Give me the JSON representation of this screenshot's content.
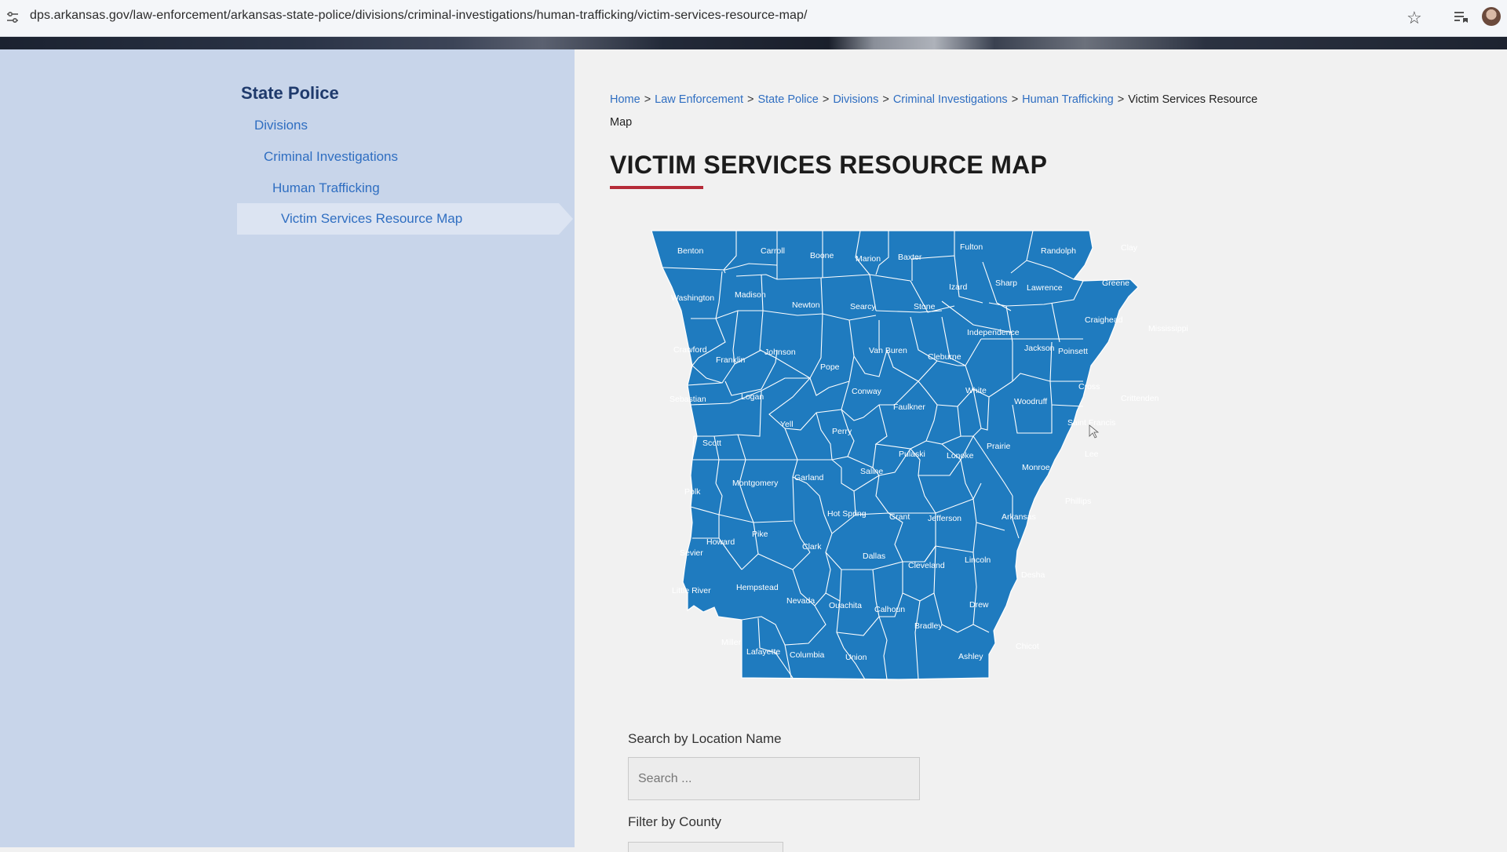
{
  "browser": {
    "url": "dps.arkansas.gov/law-enforcement/arkansas-state-police/divisions/criminal-investigations/human-trafficking/victim-services-resource-map/"
  },
  "sidebar": {
    "title": "State Police",
    "items": [
      {
        "label": "Divisions"
      },
      {
        "label": "Criminal Investigations"
      },
      {
        "label": "Human Trafficking"
      },
      {
        "label": "Victim Services Resource Map"
      }
    ]
  },
  "breadcrumb": {
    "items": [
      {
        "label": "Home"
      },
      {
        "label": "Law Enforcement"
      },
      {
        "label": "State Police"
      },
      {
        "label": "Divisions"
      },
      {
        "label": "Criminal Investigations"
      },
      {
        "label": "Human Trafficking"
      }
    ],
    "current": "Victim Services Resource Map",
    "separator": ">"
  },
  "page": {
    "title": "VICTIM SERVICES RESOURCE MAP"
  },
  "map": {
    "fill_color": "#1f7bbf",
    "border_color": "#ffffff",
    "counties": [
      "Benton",
      "Carroll",
      "Boone",
      "Marion",
      "Baxter",
      "Fulton",
      "Randolph",
      "Clay",
      "Washington",
      "Madison",
      "Newton",
      "Searcy",
      "Stone",
      "Izard",
      "Sharp",
      "Lawrence",
      "Greene",
      "Craighead",
      "Mississippi",
      "Independence",
      "Jackson",
      "Poinsett",
      "Crawford",
      "Franklin",
      "Johnson",
      "Pope",
      "Van Buren",
      "Cleburne",
      "Sebastian",
      "Logan",
      "Conway",
      "White",
      "Faulkner",
      "Woodruff",
      "Cross",
      "Crittenden",
      "Yell",
      "Perry",
      "Saint Francis",
      "Prairie",
      "Pulaski",
      "Lonoke",
      "Lee",
      "Monroe",
      "Scott",
      "Garland",
      "Saline",
      "Montgomery",
      "Polk",
      "Phillips",
      "Hot Spring",
      "Grant",
      "Jefferson",
      "Arkansas",
      "Pike",
      "Howard",
      "Sevier",
      "Clark",
      "Dallas",
      "Cleveland",
      "Lincoln",
      "Desha",
      "Little River",
      "Hempstead",
      "Nevada",
      "Ouachita",
      "Calhoun",
      "Drew",
      "Bradley",
      "Miller",
      "Lafayette",
      "Columbia",
      "Union",
      "Ashley",
      "Chicot"
    ]
  },
  "search": {
    "label": "Search by Location Name",
    "placeholder": "Search ..."
  },
  "filter": {
    "label": "Filter by County"
  }
}
